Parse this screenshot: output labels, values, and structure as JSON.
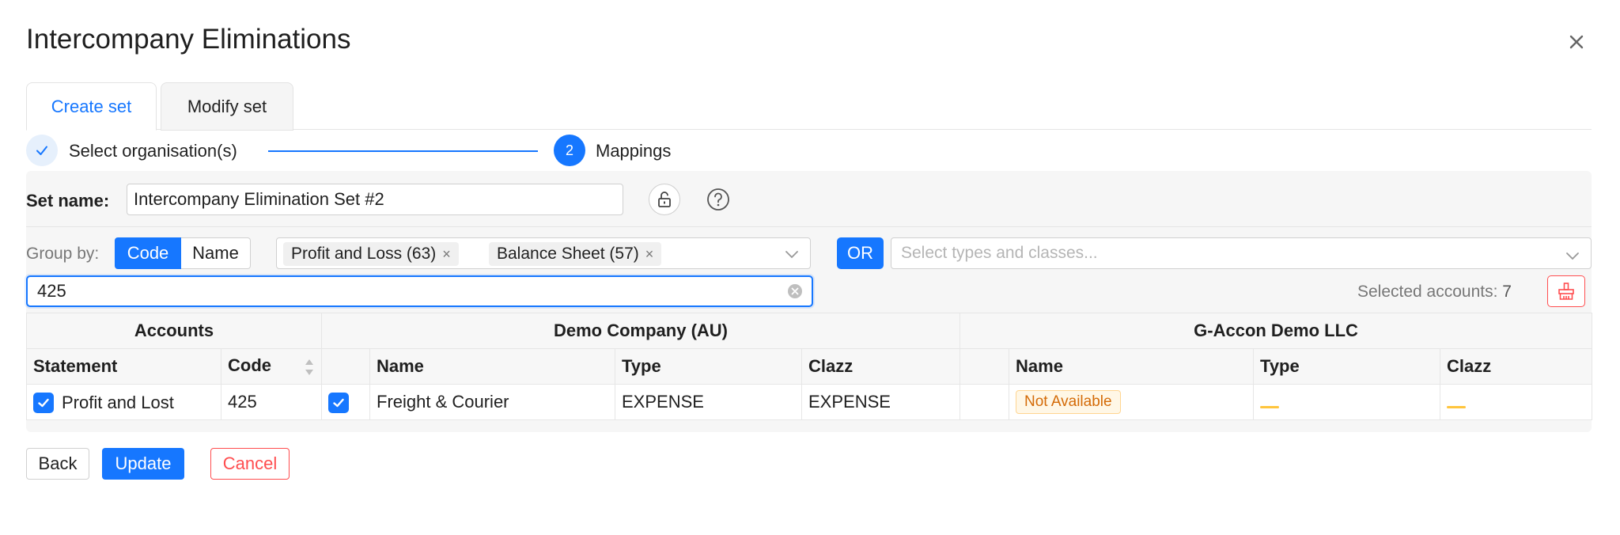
{
  "dialog": {
    "title": "Intercompany Eliminations",
    "close_icon": "close-icon"
  },
  "tabs": [
    {
      "label": "Create set",
      "active": true
    },
    {
      "label": "Modify set",
      "active": false
    }
  ],
  "steps": [
    {
      "label": "Select organisation(s)",
      "status": "done",
      "icon": "check-icon"
    },
    {
      "label": "Mappings",
      "status": "current",
      "number": "2"
    }
  ],
  "set_name": {
    "label": "Set name:",
    "value": "Intercompany Elimination Set #2",
    "lock_icon": "unlock-icon",
    "help_icon": "question-circle-icon"
  },
  "group_by": {
    "label": "Group by:",
    "options": [
      "Code",
      "Name"
    ],
    "selected": "Code"
  },
  "statement_filter": {
    "tags": [
      {
        "label": "Profit and Loss (63)"
      },
      {
        "label": "Balance Sheet (57)"
      }
    ],
    "remove_glyph": "×"
  },
  "or_label": "OR",
  "types_filter": {
    "placeholder": "Select types and classes..."
  },
  "search": {
    "value": "425"
  },
  "selected_accounts": {
    "label": "Selected accounts:",
    "count": "7"
  },
  "table": {
    "groups": [
      "Accounts",
      "Demo Company (AU)",
      "G-Accon Demo LLC"
    ],
    "columns": [
      "Statement",
      "Code",
      "",
      "Name",
      "Type",
      "Clazz",
      "",
      "Name",
      "Type",
      "Clazz"
    ],
    "rows": [
      {
        "statement": "Profit and Lost",
        "code": "425",
        "demo_name": "Freight & Courier",
        "demo_type": "EXPENSE",
        "demo_clazz": "EXPENSE",
        "gaccon_name": "Not Available",
        "gaccon_type": "",
        "gaccon_clazz": ""
      }
    ]
  },
  "footer": {
    "back": "Back",
    "update": "Update",
    "cancel": "Cancel"
  },
  "colors": {
    "primary": "#1677ff",
    "danger": "#ff4d4f",
    "warning_text": "#d46b08",
    "warning_bg": "#fff7e6"
  }
}
